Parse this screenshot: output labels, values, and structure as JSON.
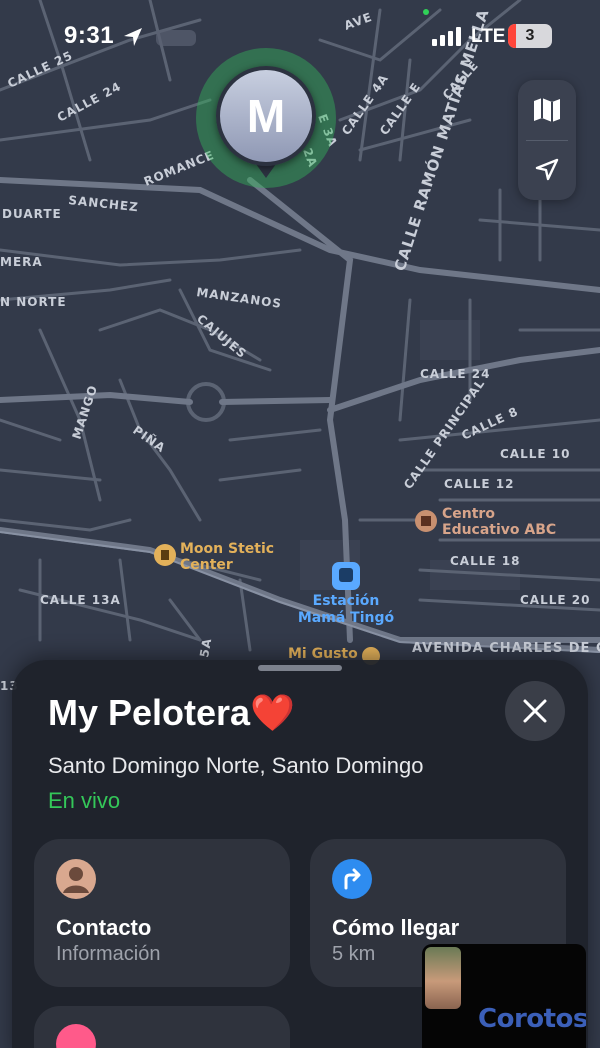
{
  "status_bar": {
    "time": "9:31",
    "network": "LTE",
    "battery": "3"
  },
  "map": {
    "streets": {
      "calle_25": "CALLE 25",
      "calle_24_top": "CALLE 24",
      "romance": "ROMANCE",
      "sanchez": "SANCHEZ",
      "duarte": "DUARTE",
      "mera": "MERA",
      "norte": "N NORTE",
      "manzanos": "MANZANOS",
      "cajujes": "CAJUJES",
      "mango": "MANGO",
      "pina": "PIÑA",
      "calle_4a": "CALLE 4A",
      "calle_3a": "CALLE 3A",
      "calle_e": "CALLE E",
      "calle_2a": "2A",
      "calle_3a_short": "E 3A",
      "ave": "AVE",
      "calle_small": "CALLE",
      "ramon": "CALLE RAMÓN MATÍAS MELLA",
      "calle_24": "CALLE 24",
      "calle_principal": "CALLE PRINCIPAL",
      "calle_8": "CALLE 8",
      "calle_10": "CALLE 10",
      "calle_12": "CALLE 12",
      "calle_18": "CALLE 18",
      "calle_20": "CALLE 20",
      "calle_13a": "CALLE 13A",
      "avenida": "AVENIDA CHARLES DE GA",
      "c5a": "5A",
      "c13": "13"
    },
    "pois": {
      "moon_1": "Moon Stetic",
      "moon_2": "Center",
      "centro_1": "Centro",
      "centro_2": "Educativo ABC",
      "estacion_1": "Estación",
      "estacion_2": "Mamá Tingó",
      "mi_gusto": "Mi Gusto"
    },
    "avatar_initial": "M",
    "colors": {
      "poi_gold": "#e3b15a",
      "poi_blue": "#5aa9ff",
      "halo_green": "#34b45a"
    }
  },
  "sheet": {
    "title": "My Pelotera❤️",
    "subtitle": "Santo Domingo Norte, Santo Domingo",
    "live_status": "En vivo",
    "cards": {
      "contact": {
        "title": "Contacto",
        "subtitle": "Información",
        "icon": "person-icon"
      },
      "directions": {
        "title": "Cómo llegar",
        "subtitle": "5 km",
        "icon": "turn-right-icon"
      }
    }
  },
  "pip": {
    "watermark": "Corotos"
  }
}
